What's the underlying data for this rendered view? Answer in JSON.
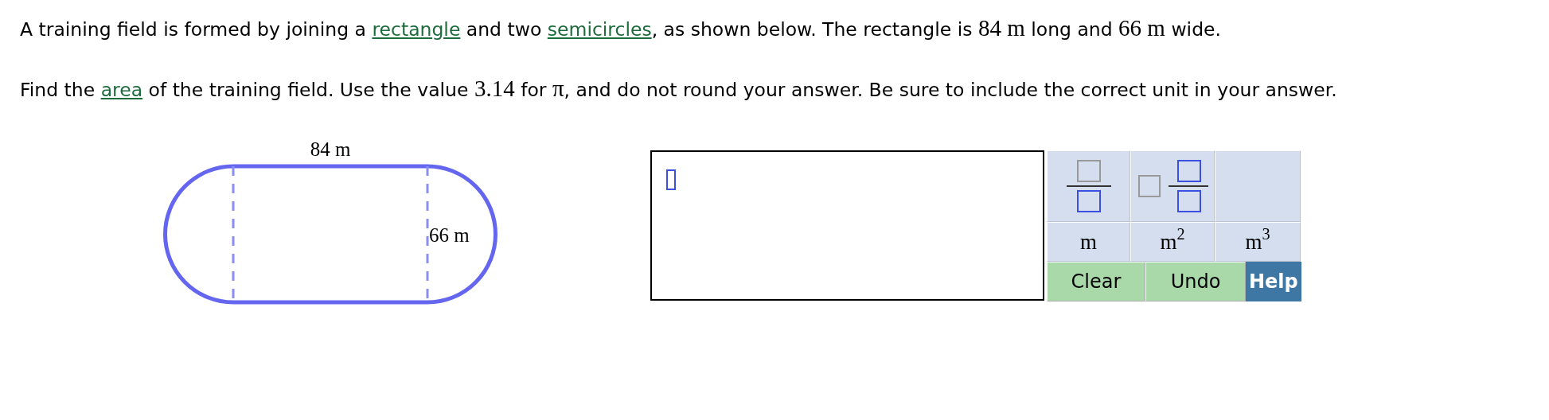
{
  "paragraphs": [
    {
      "parts": [
        {
          "kind": "text",
          "text": "A training field is formed by joining a "
        },
        {
          "kind": "link",
          "text": "rectangle"
        },
        {
          "kind": "text",
          "text": " and two "
        },
        {
          "kind": "link",
          "text": "semicircles"
        },
        {
          "kind": "text",
          "text": ", as shown below. The rectangle is "
        },
        {
          "kind": "math",
          "text": "84 m"
        },
        {
          "kind": "text",
          "text": " long and "
        },
        {
          "kind": "math",
          "text": "66 m"
        },
        {
          "kind": "text",
          "text": " wide."
        }
      ]
    },
    {
      "parts": [
        {
          "kind": "text",
          "text": "Find the "
        },
        {
          "kind": "link",
          "text": "area"
        },
        {
          "kind": "text",
          "text": " of the training field. Use the value "
        },
        {
          "kind": "math",
          "text": "3.14"
        },
        {
          "kind": "text",
          "text": " for "
        },
        {
          "kind": "math",
          "text": "π"
        },
        {
          "kind": "text",
          "text": ", and do not round your answer. Be sure to include the correct unit in your answer."
        }
      ]
    }
  ],
  "figure": {
    "length_label": "84 m",
    "width_label": "66 m"
  },
  "keypad": {
    "templates": [
      {
        "kind": "fraction"
      },
      {
        "kind": "mixed"
      },
      {
        "kind": "blank"
      }
    ],
    "units": [
      "m",
      "m$^{2}$",
      "m$^{3}$"
    ],
    "actions": [
      {
        "kind": "action",
        "label": "Clear"
      },
      {
        "kind": "action",
        "label": "Undo"
      },
      {
        "kind": "help",
        "label": "Help"
      }
    ]
  }
}
